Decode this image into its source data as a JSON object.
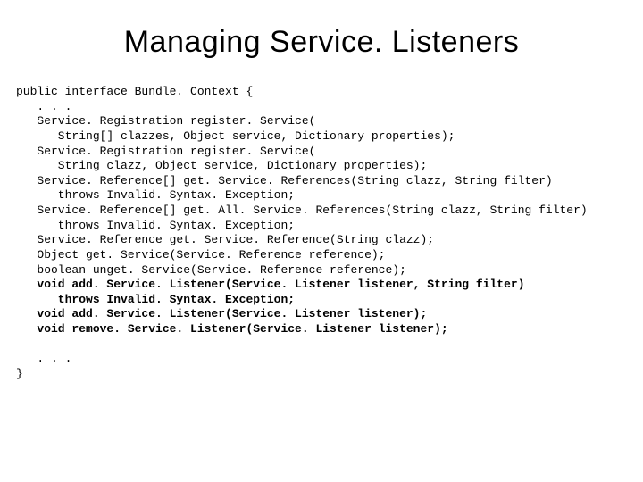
{
  "title": "Managing Service. Listeners",
  "code": {
    "l1": "public interface Bundle. Context {",
    "l2": "   . . .",
    "l3": "   Service. Registration register. Service(",
    "l4": "      String[] clazzes, Object service, Dictionary properties);",
    "l5": "   Service. Registration register. Service(",
    "l6": "      String clazz, Object service, Dictionary properties);",
    "l7": "   Service. Reference[] get. Service. References(String clazz, String filter)",
    "l8": "      throws Invalid. Syntax. Exception;",
    "l9": "   Service. Reference[] get. All. Service. References(String clazz, String filter)",
    "l10": "      throws Invalid. Syntax. Exception;",
    "l11": "   Service. Reference get. Service. Reference(String clazz);",
    "l12": "   Object get. Service(Service. Reference reference);",
    "l13": "   boolean unget. Service(Service. Reference reference);",
    "b1": "   void add. Service. Listener(Service. Listener listener, String filter)",
    "b2": "      throws Invalid. Syntax. Exception;",
    "b3": "   void add. Service. Listener(Service. Listener listener);",
    "b4": "   void remove. Service. Listener(Service. Listener listener);",
    "blank": "",
    "l14": "   . . .",
    "l15": "}"
  }
}
